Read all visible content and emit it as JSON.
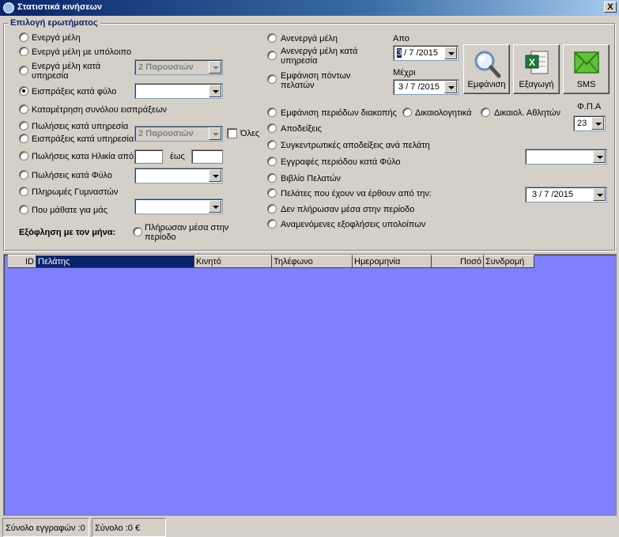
{
  "window": {
    "title": "Στατιστικά κινήσεων",
    "close_label": "X"
  },
  "group": {
    "legend": "Επιλογή ερωτήματος"
  },
  "left_options": {
    "active_members": "Ενεργά μέλη",
    "active_members_balance": "Ενεργά μέλη με υπόλοιπο",
    "active_members_by_service": "Ενεργά μέλη κατά υπηρεσία",
    "income_by_gender": "Εισπράξεις κατά φύλο",
    "total_income": "Καταμέτρηση συνόλου εισπράξεων",
    "sales_by_service": "Πωλήσεις κατά υπηρεσία",
    "income_by_service": "Εισπράξεις κατά υπηρεσία",
    "sales_by_age": "Πωλήσεις κατα Ηλικία από",
    "age_to": "έως",
    "sales_by_gender": "Πωλήσεις κατά Φύλο",
    "trainer_payments": "Πληρωμές Γυμναστών",
    "how_heard": "Που μάθατε για μάς",
    "all_label": "Όλες"
  },
  "combos": {
    "presence_1": "2 Παρουσιών",
    "presence_2": "2 Παρουσιών"
  },
  "settlement": {
    "label": "Εξόφληση με τον μήνα:",
    "option": "Πλήρωσαν μέσα στην περίοδο"
  },
  "middle_options": {
    "inactive_members": "Ανενεργά μέλη",
    "inactive_by_service": "Ανενεργά μέλη κατά υπηρεσία",
    "points": "Εμφάνιση πόντων πελατών",
    "interruption": "Εμφάνιση περιόδων διακοπής",
    "justifications": "Δικαιολογητικά",
    "athletes_justifications": "Δικαιολ. Αθλητών",
    "receipts": "Αποδείξεις",
    "summary_receipts": "Συγκεντρωτικές αποδείξεις ανά πελάτη",
    "registrations_by_gender": "Εγγραφές περιόδου κατά Φύλο",
    "customer_book": "Βιβλίο Πελατών",
    "customers_to_come": "Πελάτες που έχουν να έρθουν από την:",
    "not_paid": "Δεν πλήρωσαν μέσα στην περίοδο",
    "expected_payments": "Αναμενόμενες εξοφλήσεις υπολοίπων"
  },
  "dates": {
    "from_label": "Απο",
    "from_day": "3",
    "from_rest": " / 7 /2015",
    "to_label": "Μέχρι",
    "to_value": "3 / 7 /2015",
    "since_value": "3 / 7 /2015"
  },
  "buttons": {
    "show": "Εμφάνιση",
    "export": "Εξαγωγή",
    "sms": "SMS"
  },
  "vat": {
    "label": "Φ.Π.Α",
    "value": "23"
  },
  "grid": {
    "columns": [
      "ID",
      "Πελάτης",
      "Κινητό",
      "Τηλέφωνο",
      "Ημερομηνία",
      "Ποσό",
      "Συνδρομή"
    ]
  },
  "status": {
    "records": "Σύνολο εγγραφών :0",
    "total": "Σύνολο :0 €"
  }
}
